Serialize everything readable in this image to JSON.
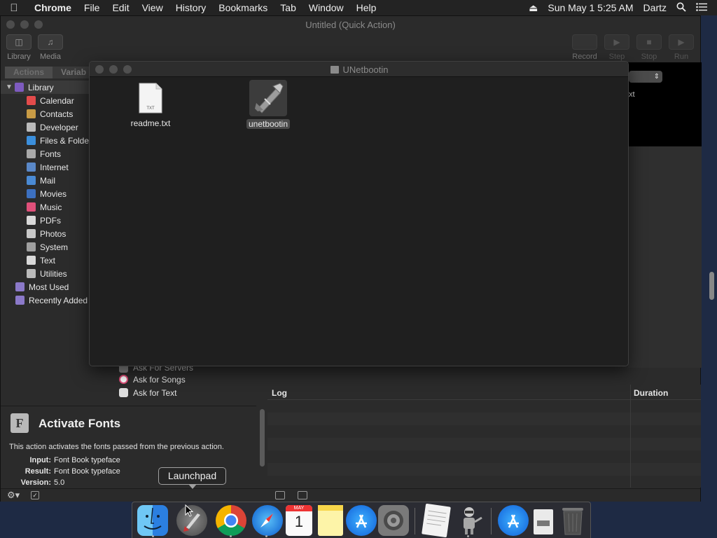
{
  "menubar": {
    "app": "Chrome",
    "items": [
      "File",
      "Edit",
      "View",
      "History",
      "Bookmarks",
      "Tab",
      "Window",
      "Help"
    ],
    "clock": "Sun May 1  5:25 AM",
    "user": "Dartz"
  },
  "automator": {
    "title": "Untitled (Quick Action)",
    "toolbar": {
      "library": "Library",
      "media": "Media",
      "record": "Record",
      "step": "Step",
      "stop": "Stop",
      "run": "Run"
    },
    "tabs": {
      "actions": "Actions",
      "variables": "Variab"
    },
    "library": {
      "root": "Library",
      "items": [
        {
          "label": "Calendar",
          "icon": "calendar-icon",
          "color": "#e34b4b"
        },
        {
          "label": "Contacts",
          "icon": "contacts-icon",
          "color": "#c89b45"
        },
        {
          "label": "Developer",
          "icon": "developer-icon",
          "color": "#bbbbbb"
        },
        {
          "label": "Files & Folders",
          "icon": "finder-icon",
          "color": "#3b8fdc"
        },
        {
          "label": "Fonts",
          "icon": "font-icon",
          "color": "#a8a8a8"
        },
        {
          "label": "Internet",
          "icon": "globe-icon",
          "color": "#5a88c8"
        },
        {
          "label": "Mail",
          "icon": "mail-icon",
          "color": "#4a8ad4"
        },
        {
          "label": "Movies",
          "icon": "movies-icon",
          "color": "#3c70c0"
        },
        {
          "label": "Music",
          "icon": "music-icon",
          "color": "#e0507a"
        },
        {
          "label": "PDFs",
          "icon": "pdf-icon",
          "color": "#d9d9d9"
        },
        {
          "label": "Photos",
          "icon": "photos-icon",
          "color": "#c9c9c9"
        },
        {
          "label": "System",
          "icon": "system-icon",
          "color": "#a0a0a0"
        },
        {
          "label": "Text",
          "icon": "text-icon",
          "color": "#d9d9d9"
        },
        {
          "label": "Utilities",
          "icon": "utilities-icon",
          "color": "#bbbbbb"
        }
      ],
      "smart": [
        {
          "label": "Most Used",
          "icon": "smart-folder-icon"
        },
        {
          "label": "Recently Added",
          "icon": "smart-folder-icon"
        }
      ]
    },
    "actions": [
      {
        "label": "Ask For Servers",
        "icon": "network-icon"
      },
      {
        "label": "Ask for Songs",
        "icon": "music-icon"
      },
      {
        "label": "Ask for Text",
        "icon": "text-icon"
      }
    ],
    "description": {
      "title": "Activate Fonts",
      "body": "This action activates the fonts passed from the previous action.",
      "input_label": "Input:",
      "input_value": "Font Book typeface",
      "result_label": "Result:",
      "result_value": "Font Book typeface",
      "version_label": "Version:",
      "version_value": "5.0"
    },
    "workflow_text": "xt",
    "log": {
      "col_log": "Log",
      "col_duration": "Duration"
    }
  },
  "finder": {
    "title": "UNetbootin",
    "files": [
      {
        "name": "readme.txt",
        "icon": "text-file-icon",
        "badge": "TXT"
      },
      {
        "name": "unetbootin",
        "icon": "unetbootin-app-icon"
      }
    ]
  },
  "tooltip": "Launchpad",
  "dock": {
    "apps": [
      "Finder",
      "Launchpad",
      "Chrome",
      "Safari",
      "Calendar",
      "Notes",
      "App Store",
      "System Preferences",
      "TextEdit",
      "Automator",
      "App Store Downloads",
      "Document",
      "Trash"
    ],
    "calendar_month": "MAY",
    "calendar_day": "1"
  }
}
